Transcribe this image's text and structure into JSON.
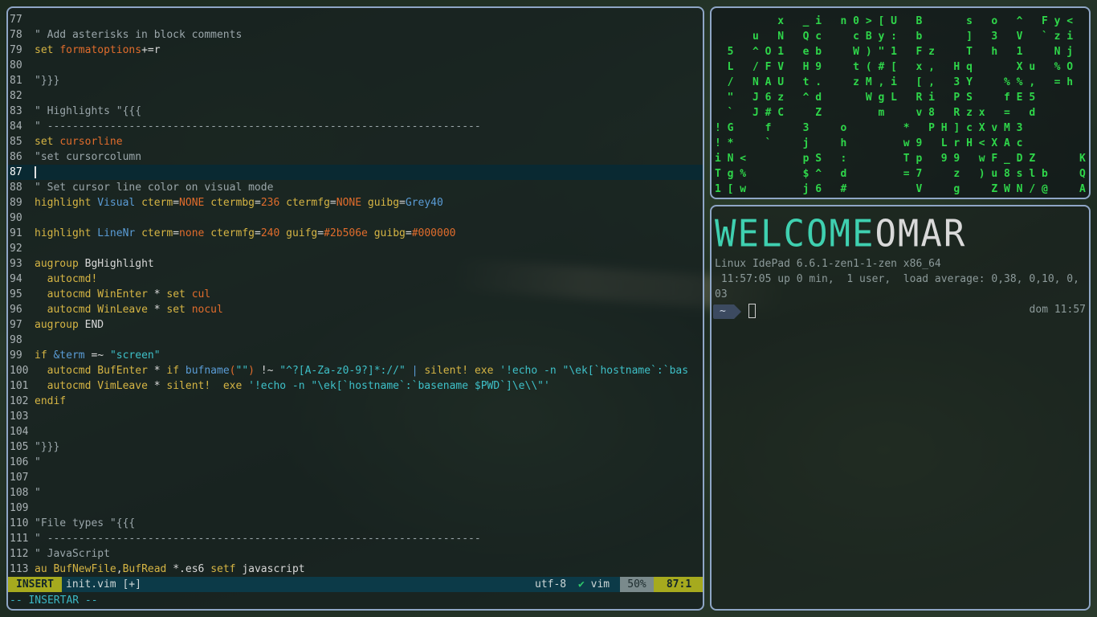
{
  "vim": {
    "lines": [
      {
        "n": "77",
        "parts": []
      },
      {
        "n": "78",
        "parts": [
          [
            "cm",
            "\" Add asterisks in block comments"
          ]
        ]
      },
      {
        "n": "79",
        "parts": [
          [
            "kw",
            "set "
          ],
          [
            "op",
            "formatoptions"
          ],
          [
            "wht",
            "+=r"
          ]
        ]
      },
      {
        "n": "80",
        "parts": []
      },
      {
        "n": "81",
        "parts": [
          [
            "cm",
            "\"}}}"
          ]
        ]
      },
      {
        "n": "82",
        "parts": []
      },
      {
        "n": "83",
        "parts": [
          [
            "cm",
            "\" Highlights \"{{{"
          ]
        ]
      },
      {
        "n": "84",
        "parts": [
          [
            "cm",
            "\" ---------------------------------------------------------------------"
          ]
        ]
      },
      {
        "n": "85",
        "parts": [
          [
            "kw",
            "set "
          ],
          [
            "op",
            "cursorline"
          ]
        ]
      },
      {
        "n": "86",
        "parts": [
          [
            "cm",
            "\"set cursorcolumn"
          ]
        ]
      },
      {
        "n": "87",
        "parts": [],
        "current": true
      },
      {
        "n": "88",
        "parts": [
          [
            "cm",
            "\" Set cursor line color on visual mode"
          ]
        ]
      },
      {
        "n": "89",
        "parts": [
          [
            "kw",
            "highlight "
          ],
          [
            "blu",
            "Visual "
          ],
          [
            "kw",
            "cterm"
          ],
          [
            "wht",
            "="
          ],
          [
            "op",
            "NONE "
          ],
          [
            "kw",
            "ctermbg"
          ],
          [
            "wht",
            "="
          ],
          [
            "op",
            "236 "
          ],
          [
            "kw",
            "ctermfg"
          ],
          [
            "wht",
            "="
          ],
          [
            "op",
            "NONE "
          ],
          [
            "kw",
            "guibg"
          ],
          [
            "wht",
            "="
          ],
          [
            "blu",
            "Grey40"
          ]
        ]
      },
      {
        "n": "90",
        "parts": []
      },
      {
        "n": "91",
        "parts": [
          [
            "kw",
            "highlight "
          ],
          [
            "blu",
            "LineNr "
          ],
          [
            "kw",
            "cterm"
          ],
          [
            "wht",
            "="
          ],
          [
            "op",
            "none "
          ],
          [
            "kw",
            "ctermfg"
          ],
          [
            "wht",
            "="
          ],
          [
            "op",
            "240 "
          ],
          [
            "kw",
            "guifg"
          ],
          [
            "wht",
            "="
          ],
          [
            "op",
            "#2b506e "
          ],
          [
            "kw",
            "guibg"
          ],
          [
            "wht",
            "="
          ],
          [
            "op",
            "#000000"
          ]
        ]
      },
      {
        "n": "92",
        "parts": []
      },
      {
        "n": "93",
        "parts": [
          [
            "kw",
            "augroup "
          ],
          [
            "wht",
            "BgHighlight"
          ]
        ]
      },
      {
        "n": "94",
        "parts": [
          [
            "kw",
            "  autocmd!"
          ]
        ]
      },
      {
        "n": "95",
        "parts": [
          [
            "kw",
            "  autocmd "
          ],
          [
            "kw",
            "WinEnter "
          ],
          [
            "wht",
            "* "
          ],
          [
            "kw",
            "set "
          ],
          [
            "op",
            "cul"
          ]
        ]
      },
      {
        "n": "96",
        "parts": [
          [
            "kw",
            "  autocmd "
          ],
          [
            "kw",
            "WinLeave "
          ],
          [
            "wht",
            "* "
          ],
          [
            "kw",
            "set "
          ],
          [
            "op",
            "nocul"
          ]
        ]
      },
      {
        "n": "97",
        "parts": [
          [
            "kw",
            "augroup "
          ],
          [
            "wht",
            "END"
          ]
        ]
      },
      {
        "n": "98",
        "parts": []
      },
      {
        "n": "99",
        "parts": [
          [
            "kw",
            "if "
          ],
          [
            "blu",
            "&term "
          ],
          [
            "wht",
            "=~ "
          ],
          [
            "str",
            "\"screen\""
          ]
        ]
      },
      {
        "n": "100",
        "parts": [
          [
            "kw",
            "  autocmd "
          ],
          [
            "kw",
            "BufEnter "
          ],
          [
            "wht",
            "* "
          ],
          [
            "kw",
            "if "
          ],
          [
            "blu",
            "bufname"
          ],
          [
            "op",
            "("
          ],
          [
            "str",
            "\"\""
          ],
          [
            "op",
            ")"
          ],
          [
            "wht",
            " !~ "
          ],
          [
            "str",
            "\"^?[A-Za-z0-9?]*://\""
          ],
          [
            "wht",
            " "
          ],
          [
            "blu",
            "| "
          ],
          [
            "kw",
            "silent! exe "
          ],
          [
            "str",
            "'!echo -n \"\\ek[`hostname`:`bas"
          ]
        ]
      },
      {
        "n": "101",
        "parts": [
          [
            "kw",
            "  autocmd "
          ],
          [
            "kw",
            "VimLeave "
          ],
          [
            "wht",
            "* "
          ],
          [
            "kw",
            "silent!  exe "
          ],
          [
            "str",
            "'!echo -n \"\\ek[`hostname`:`basename $PWD`]\\e\\\\\"'"
          ]
        ]
      },
      {
        "n": "102",
        "parts": [
          [
            "kw",
            "endif"
          ]
        ]
      },
      {
        "n": "103",
        "parts": []
      },
      {
        "n": "104",
        "parts": []
      },
      {
        "n": "105",
        "parts": [
          [
            "cm",
            "\"}}}"
          ]
        ]
      },
      {
        "n": "106",
        "parts": [
          [
            "cm",
            "\""
          ]
        ]
      },
      {
        "n": "107",
        "parts": []
      },
      {
        "n": "108",
        "parts": [
          [
            "cm",
            "\""
          ]
        ]
      },
      {
        "n": "109",
        "parts": []
      },
      {
        "n": "110",
        "parts": [
          [
            "cm",
            "\"File types \"{{{"
          ]
        ]
      },
      {
        "n": "111",
        "parts": [
          [
            "cm",
            "\" ---------------------------------------------------------------------"
          ]
        ]
      },
      {
        "n": "112",
        "parts": [
          [
            "cm",
            "\" JavaScript"
          ]
        ]
      },
      {
        "n": "113",
        "parts": [
          [
            "kw",
            "au "
          ],
          [
            "kw",
            "BufNewFile"
          ],
          [
            "wht",
            ","
          ],
          [
            "kw",
            "BufRead "
          ],
          [
            "wht",
            "*.es6 "
          ],
          [
            "kw",
            "setf "
          ],
          [
            "wht",
            "javascript"
          ]
        ]
      }
    ],
    "status": {
      "mode": "INSERT",
      "filename": "init.vim [+]",
      "encoding": "utf-8",
      "check": "✔",
      "filetype": "vim",
      "percent": "50%",
      "position": "87:1"
    },
    "cmdline": "-- INSERTAR --"
  },
  "matrix": {
    "rows": [
      "          x   _ i   n 0 > [ U   B       s   o   ^   F y <",
      "      u   N   Q c     c B y :   b       ]   3   V   ` z i",
      "  5   ^ O 1   e b     W ) \" 1   F z     T   h   1     N j",
      "  L   / F V   H 9     t ( # [   x ,   H q       X u   % O",
      "  /   N A U   t .     z M , i   [ ,   3 Y     % % ,   = h",
      "  \"   J 6 z   ^ d       W g L   R i   P S     f E 5",
      "  `   J # C     Z         m     v 8   R z x   =   d",
      "! G     f     3     o         *   P H ] c X v M 3",
      "! *     `     j     h         w 9   L r H < X A c",
      "i N <         p S   :         T p   9 9   w F _ D Z       K",
      "T g %         $ ^   d         = 7     z   ) u 8 s l b     Q",
      "1 [ w         j 6   #           V     g     Z W N / @     A"
    ]
  },
  "terminal": {
    "banner_part1": "WELCOME ",
    "banner_part2": "OMAR",
    "uname": "Linux IdePad 6.6.1-zen1-1-zen x86_64",
    "uptime": " 11:57:05 up 0 min,  1 user,  load average: 0,38, 0,10, 0,",
    "uptime_wrap": "03",
    "prompt_dir": "~",
    "right_time": "dom 11:57"
  }
}
